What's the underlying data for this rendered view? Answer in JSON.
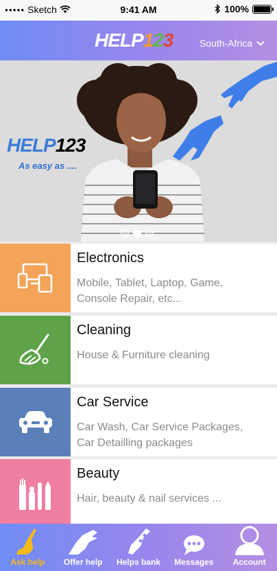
{
  "status_bar": {
    "carrier": "Sketch",
    "time": "9:41 AM",
    "battery": "100%"
  },
  "header": {
    "logo": {
      "part1": "HELP",
      "d1": "1",
      "d2": "2",
      "d3": "3"
    },
    "region": "South-Africa"
  },
  "hero": {
    "logo": {
      "part1": "HELP",
      "d1": "1",
      "d2": "2",
      "d3": "3"
    },
    "tagline": "As easy as ....",
    "carousel": {
      "count": 3,
      "active_index": 1
    }
  },
  "categories": [
    {
      "title": "Electronics",
      "desc1": "Mobile, Tablet, Laptop, Game,",
      "desc2": "Console Repair, etc...",
      "color": "#f3a458",
      "icon": "devices-icon"
    },
    {
      "title": "Cleaning",
      "desc1": "House & Furniture cleaning",
      "desc2": "",
      "color": "#5fa24a",
      "icon": "broom-icon"
    },
    {
      "title": "Car Service",
      "desc1": "Car Wash, Car Service Packages,",
      "desc2": "Car Detailling packages",
      "color": "#5b7fb8",
      "icon": "car-icon"
    },
    {
      "title": "Beauty",
      "desc1": "Hair, beauty & nail services ...",
      "desc2": "",
      "color": "#f07ea0",
      "icon": "beauty-tools-icon"
    }
  ],
  "tabs": [
    {
      "label": "Ask help",
      "icon": "ask-help-hand-icon",
      "active": true
    },
    {
      "label": "Offer help",
      "icon": "offer-help-hand-icon",
      "active": false
    },
    {
      "label": "Helps bank",
      "icon": "helps-bank-hand-icon",
      "active": false
    },
    {
      "label": "Messages",
      "icon": "messages-icon",
      "active": false
    },
    {
      "label": "Account",
      "icon": "account-icon",
      "active": false
    }
  ],
  "colors": {
    "header_start": "#6f8cf5",
    "header_end": "#b38fe3",
    "tab_active": "#f5b91a"
  }
}
